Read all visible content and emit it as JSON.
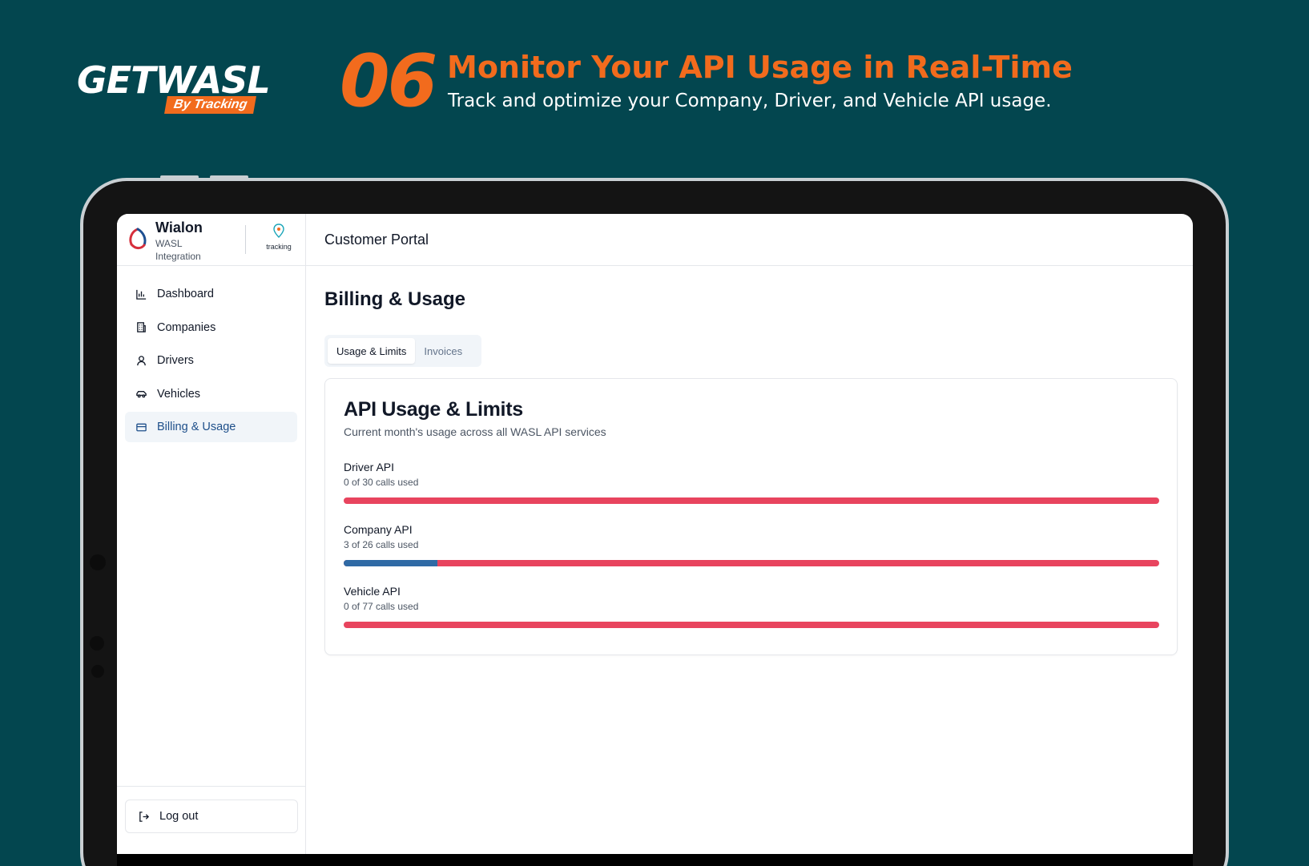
{
  "promo": {
    "logo_word": "GETWASL",
    "logo_sub": "By Tracking",
    "step": "06",
    "headline": "Monitor Your API Usage in Real-Time",
    "subline": "Track and optimize your Company, Driver, and Vehicle API usage."
  },
  "brand": {
    "title": "Wialon",
    "subtitle": "WASL Integration",
    "partner": "tracking"
  },
  "sidebar": {
    "items": [
      {
        "label": "Dashboard",
        "icon": "bar-chart-icon",
        "active": false
      },
      {
        "label": "Companies",
        "icon": "building-icon",
        "active": false
      },
      {
        "label": "Drivers",
        "icon": "user-icon",
        "active": false
      },
      {
        "label": "Vehicles",
        "icon": "car-icon",
        "active": false
      },
      {
        "label": "Billing & Usage",
        "icon": "credit-card-icon",
        "active": true
      }
    ],
    "logout_label": "Log out"
  },
  "topbar": {
    "title": "Customer Portal"
  },
  "main": {
    "page_title": "Billing & Usage",
    "tabs": [
      {
        "label": "Usage & Limits",
        "active": true
      },
      {
        "label": "Invoices",
        "active": false
      }
    ],
    "card": {
      "title": "API Usage & Limits",
      "description": "Current month's usage across all WASL API services",
      "usages": [
        {
          "name": "Driver API",
          "count_text": "0 of 30 calls used",
          "used": 0,
          "limit": 30
        },
        {
          "name": "Company API",
          "count_text": "3 of 26 calls used",
          "used": 3,
          "limit": 26
        },
        {
          "name": "Vehicle API",
          "count_text": "0 of 77 calls used",
          "used": 0,
          "limit": 77
        }
      ]
    }
  },
  "colors": {
    "background": "#03464f",
    "accent": "#f26b1d",
    "active_nav": "#1e4f8a",
    "bar_remaining": "#e8445e",
    "bar_used": "#2f6aa5"
  }
}
